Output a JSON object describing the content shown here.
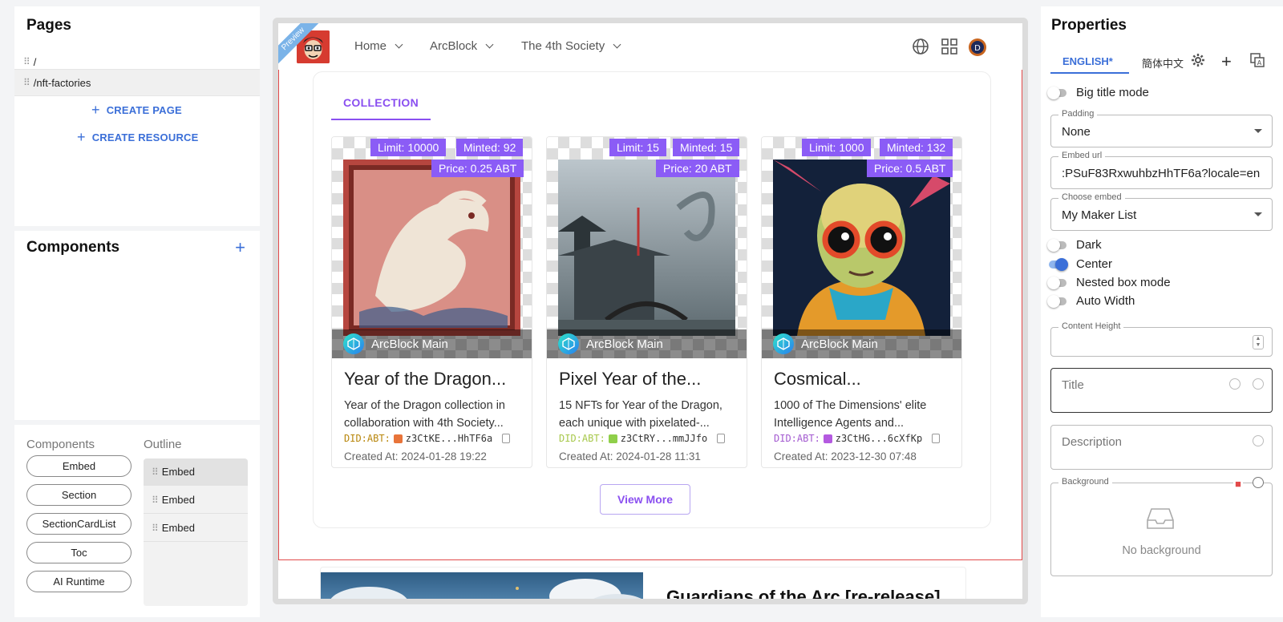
{
  "pages_panel": {
    "title": "Pages",
    "pages": [
      {
        "path": "/"
      },
      {
        "path": "/nft-factories"
      }
    ],
    "create_page": "CREATE PAGE",
    "create_resource": "CREATE RESOURCE"
  },
  "components_panel": {
    "title": "Components"
  },
  "palette": {
    "components_header": "Components",
    "outline_header": "Outline",
    "components": [
      "Embed",
      "Section",
      "SectionCardList",
      "Toc",
      "AI Runtime"
    ],
    "outline": [
      "Embed",
      "Embed",
      "Embed"
    ]
  },
  "preview": {
    "ribbon": "Preview",
    "nav": [
      "Home",
      "ArcBlock",
      "The 4th Society"
    ],
    "collection_tab": "COLLECTION",
    "cards": [
      {
        "limit": "Limit: 10000",
        "minted": "Minted: 92",
        "price": "Price: 0.25 ABT",
        "chain": "ArcBlock Main",
        "title": "Year of the Dragon...",
        "desc": "Year of the Dragon collection in collaboration with 4th Society...",
        "did_prefix": "DID:ABT:",
        "did": "z3CtKE...HhTF6a",
        "created": "Created At: 2024-01-28 19:22",
        "dot_color": "#e8743a"
      },
      {
        "limit": "Limit: 15",
        "minted": "Minted: 15",
        "price": "Price: 20 ABT",
        "chain": "ArcBlock Main",
        "title": "Pixel Year of the...",
        "desc": "15 NFTs for Year of the Dragon, each unique with pixelated-...",
        "did_prefix": "DID:ABT:",
        "did": "z3CtRY...mmJJfo",
        "created": "Created At: 2024-01-28 11:31",
        "dot_color": "#8fcf4a"
      },
      {
        "limit": "Limit: 1000",
        "minted": "Minted: 132",
        "price": "Price: 0.5 ABT",
        "chain": "ArcBlock Main",
        "title": "Cosmical...",
        "desc": "1000 of The Dimensions' elite Intelligence Agents and...",
        "did_prefix": "DID:ABT:",
        "did": "z3CtHG...6cXfKp",
        "created": "Created At: 2023-12-30 07:48",
        "dot_color": "#b45ae0"
      }
    ],
    "view_more": "View More",
    "next_section_title": "Guardians of the Arc [re-release]"
  },
  "properties": {
    "title": "Properties",
    "lang_tabs": [
      "ENGLISH*",
      "簡体中文"
    ],
    "big_title_mode": "Big title mode",
    "padding_label": "Padding",
    "padding_value": "None",
    "embed_url_label": "Embed url",
    "embed_url_value": ":PSuF83RxwuhbzHhTF6a?locale=en",
    "choose_embed_label": "Choose embed",
    "choose_embed_value": "My Maker List",
    "dark": "Dark",
    "center": "Center",
    "nested_box_mode": "Nested box mode",
    "auto_width": "Auto Width",
    "content_height_label": "Content Height",
    "title_placeholder": "Title",
    "description_placeholder": "Description",
    "background_label": "Background",
    "no_background": "No background"
  },
  "colors": {
    "accent": "#3b6fd8",
    "purple": "#8b5cf6",
    "selection_red": "#e24a4a"
  }
}
